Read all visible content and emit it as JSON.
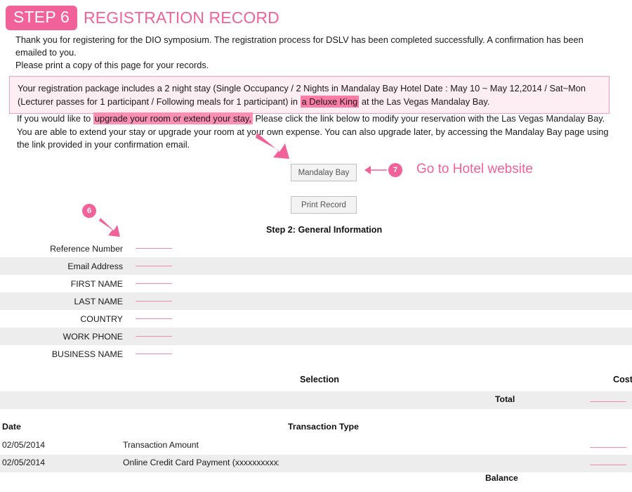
{
  "header": {
    "step_badge": "STEP 6",
    "title": "REGISTRATION RECORD"
  },
  "intro": {
    "line1": "Thank you for registering for the DIO symposium. The registration process for DSLV has been completed successfully. A confirmation has been emailed to you.",
    "line2": "Please print a copy of this page for your records."
  },
  "package_box": {
    "text_before_highlight": "Your registration package includes a 2 night stay (Single Occupancy / 2 Nights in Mandalay Bay Hotel Date : May 10 ~ May 12,2014 / Sat~Mon (Lecturer passes for 1 participant / Following meals for 1 participant) in ",
    "highlight": "a Deluxe King",
    "text_after_highlight": " at the Las Vegas Mandalay Bay."
  },
  "upgrade": {
    "text_before_highlight": "If you would like to ",
    "highlight": "upgrade your room or extend your stay,",
    "text_after_highlight": " Please click the link below to modify your reservation with the Las Vegas Mandalay Bay. You are able to extend your stay or upgrade your room at your own expense. You can also upgrade later, by accessing the Mandalay Bay page using the link provided in your confirmation email."
  },
  "buttons": {
    "mandalay_bay": "Mandalay Bay",
    "print_record": "Print Record"
  },
  "annotations": {
    "step7_number": "7",
    "step7_text": "Go to Hotel website",
    "step6_number": "6"
  },
  "form": {
    "heading": "Step 2: General Information",
    "rows": [
      {
        "label": "Reference Number",
        "shaded": false
      },
      {
        "label": "Email Address",
        "shaded": true
      },
      {
        "label": "FIRST NAME",
        "shaded": false
      },
      {
        "label": "LAST NAME",
        "shaded": true
      },
      {
        "label": "COUNTRY",
        "shaded": false
      },
      {
        "label": "WORK PHONE",
        "shaded": true
      },
      {
        "label": "BUSINESS NAME",
        "shaded": false
      }
    ]
  },
  "selection_table": {
    "selection_header": "Selection",
    "cost_header": "Cost",
    "total_label": "Total"
  },
  "transactions": {
    "date_header": "Date",
    "type_header": "Transaction Type",
    "rows": [
      {
        "date": "02/05/2014",
        "type": "Transaction Amount",
        "shaded": false
      },
      {
        "date": "02/05/2014",
        "type": "Online Credit Card Payment (xxxxxxxxxxxxx",
        "shaded": true
      }
    ],
    "balance_label": "Balance"
  },
  "colors": {
    "accent_pink": "#f2629a",
    "highlight_pink": "#fc7ca8",
    "box_bg": "#fdeef3",
    "box_border": "#f2a2bf",
    "row_shade": "#ededed",
    "dash_pink": "#f58aae"
  }
}
